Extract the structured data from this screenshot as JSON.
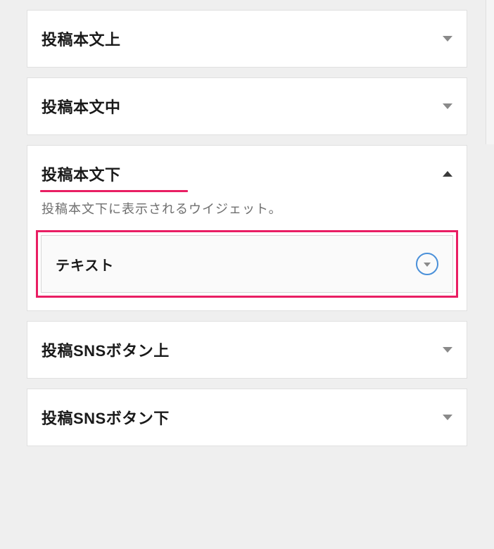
{
  "panels": [
    {
      "title": "投稿本文上",
      "expanded": false
    },
    {
      "title": "投稿本文中",
      "expanded": false
    },
    {
      "title": "投稿本文下",
      "expanded": true,
      "description": "投稿本文下に表示されるウイジェット。",
      "widget": {
        "title": "テキスト"
      }
    },
    {
      "title": "投稿SNSボタン上",
      "expanded": false
    },
    {
      "title": "投稿SNSボタン下",
      "expanded": false
    }
  ]
}
